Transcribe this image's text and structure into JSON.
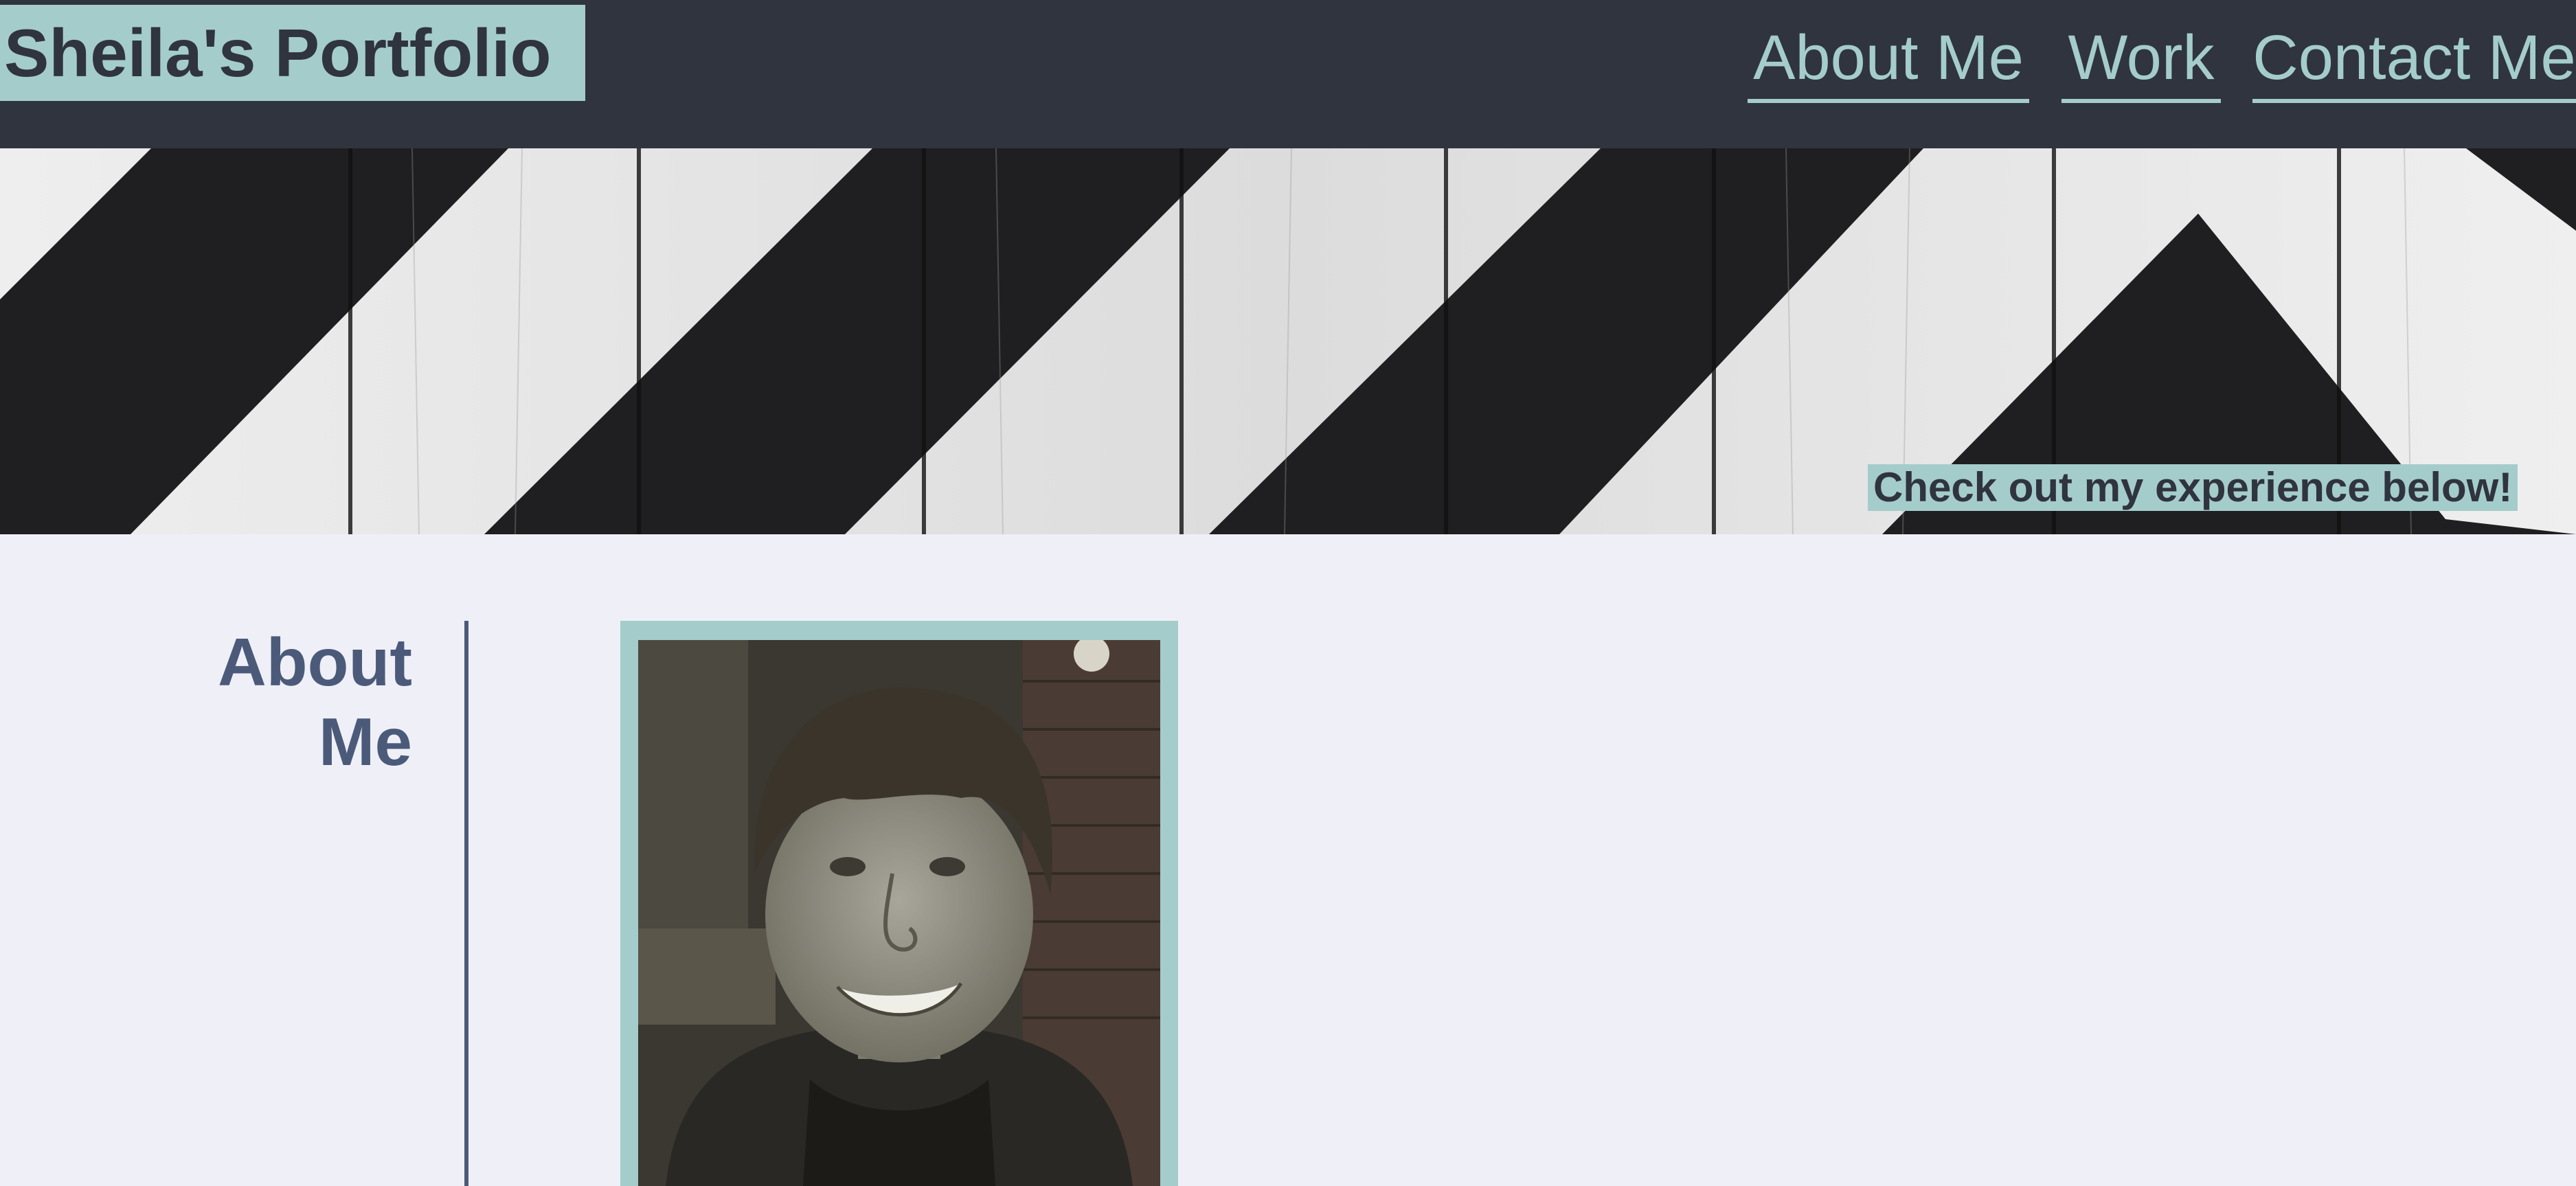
{
  "header": {
    "brand": "Sheila's Portfolio",
    "nav": [
      {
        "label": "About Me"
      },
      {
        "label": "Work"
      },
      {
        "label": "Contact Me"
      }
    ]
  },
  "hero": {
    "caption": "Check out my experience below!"
  },
  "about": {
    "heading_line1": "About",
    "heading_line2": "Me"
  },
  "colors": {
    "header_bg": "#30343f",
    "accent": "#a4cccb",
    "page_bg": "#eff0f7",
    "heading": "#4c5a7a"
  }
}
